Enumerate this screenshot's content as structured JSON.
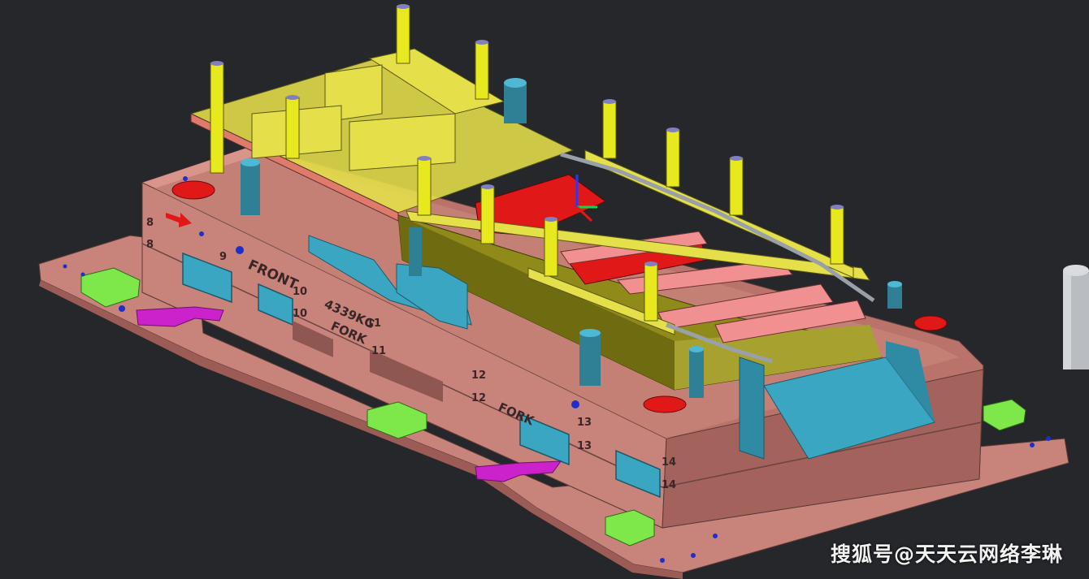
{
  "scene": "cad-stamping-die-assembly",
  "colors": {
    "background": "#25272b",
    "die_body": "#c8837a",
    "die_shadow": "#a8655e",
    "plate_yellow": "#e5e04a",
    "pillar_yellow": "#e8e81e",
    "part_teal": "#3aa6c2",
    "part_red": "#e01818",
    "part_green": "#7ee84a",
    "part_magenta": "#cc22cc",
    "olive": "#8f8a1a",
    "pink": "#f09090"
  },
  "die_labels": {
    "front": "FRONT",
    "weight": "4339KG",
    "fork_1": "FORK",
    "fork_2": "FORK",
    "n8a": "8",
    "n8b": "8",
    "n9": "9",
    "n10a": "10",
    "n10b": "10",
    "n11a": "11",
    "n11b": "11",
    "n12a": "12",
    "n12b": "12",
    "n13a": "13",
    "n13b": "13",
    "n14a": "14",
    "n14b": "14"
  },
  "watermark": "搜狐号@天天云网络李琳"
}
